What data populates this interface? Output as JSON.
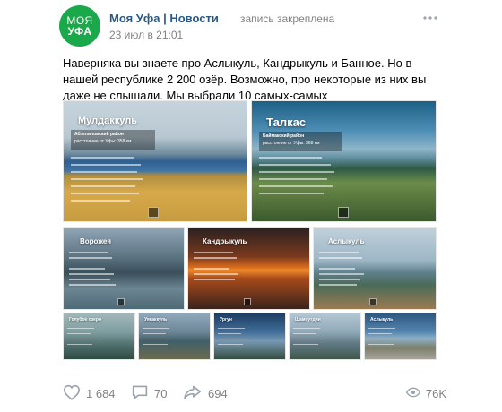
{
  "header": {
    "avatar_line1": "МОЯ",
    "avatar_line2": "УФА",
    "author": "Моя Уфа | Новости",
    "pinned": "запись закреплена",
    "date": "23 июл в 21:01"
  },
  "post": {
    "text": "Наверняка вы знаете про Аслыкуль, Кандрыкуль и Банное. Но в нашей республике 2 200 озёр. Возможно, про некоторые из них вы даже не слышали. Мы выбрали 10 самых-самых"
  },
  "photos": [
    {
      "title": "Мулдаккуль",
      "subtitle": "Абзелиловский район",
      "distance": "расстояние от Уфы: 358 км"
    },
    {
      "title": "Талкас",
      "subtitle": "Баймакский район",
      "distance": "расстояние от Уфы: 368 км"
    },
    {
      "title": "Ворожея",
      "subtitle": "",
      "distance": ""
    },
    {
      "title": "Кандрыкуль",
      "subtitle": "",
      "distance": ""
    },
    {
      "title": "Аслыкуль",
      "subtitle": "",
      "distance": ""
    },
    {
      "title": "Голубое озеро",
      "subtitle": "",
      "distance": ""
    },
    {
      "title": "Уякаккуль",
      "subtitle": "",
      "distance": ""
    },
    {
      "title": "Ургун",
      "subtitle": "",
      "distance": ""
    },
    {
      "title": "Шамсутдин",
      "subtitle": "",
      "distance": ""
    },
    {
      "title": "Аслыкуль",
      "subtitle": "",
      "distance": ""
    }
  ],
  "footer": {
    "likes": "1 684",
    "comments": "70",
    "shares": "694",
    "views": "76K"
  },
  "colors": {
    "link": "#2a5885",
    "meta": "#828282",
    "avatar_bg": "#19a84a"
  },
  "icons": {
    "more": "more-horizontal-icon",
    "like": "heart-icon",
    "comment": "comment-icon",
    "share": "share-icon",
    "views": "eye-icon"
  }
}
